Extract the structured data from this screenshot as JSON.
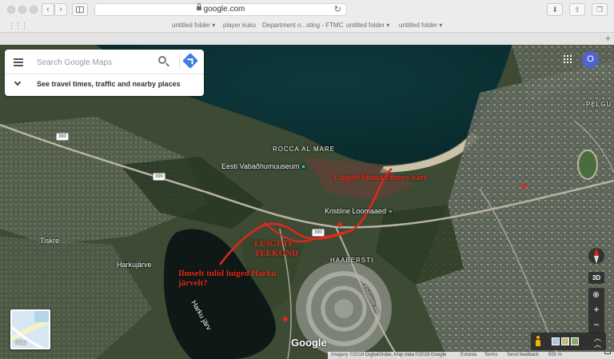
{
  "browser": {
    "url": "google.com",
    "bookmarks": [
      "untitled folder",
      "player kuku",
      "Department o...sting - FTMC",
      "untitled folder",
      "untitled folder"
    ]
  },
  "maps": {
    "search": {
      "placeholder": "Search Google Maps"
    },
    "travel_prompt": "See travel times, traffic and nearby places",
    "avatar_initial": "O",
    "map_type_label": "Map",
    "logo": "Google",
    "btn_3d": "3D",
    "zoom_in": "+",
    "zoom_out": "−",
    "labels": {
      "rocca_al_mare": "ROCCA AL MARE",
      "museum": "Eesti Vabaõhumuuseum",
      "kristiine": "Kristiine Loomaaed",
      "haabersti": "HAABERSTI",
      "tiskre": "Tiskre",
      "harkujarve": "Harkujärve",
      "harku_jarv": "Harku järv",
      "pelgu": "PELGU",
      "ehitajate": "Ehitajate tee"
    },
    "road_numbers": [
      "390",
      "390",
      "390"
    ],
    "annotations": {
      "a1": "Luiged lõunad mere äärt",
      "a2_line1": "LUIGETE",
      "a2_line2": "TEEKOND",
      "a3_line1": "Ilmselt tulid luiged Harku",
      "a3_line2": "järvelt?"
    },
    "footer": {
      "imagery": "Imagery ©2019 DigitalGlobe, Map data ©2019 Google",
      "country": "Estonia",
      "terms": "Terms",
      "feedback": "Send feedback",
      "scale": "500 m"
    },
    "colors": {
      "annotation": "#e0281c",
      "route": "#e0281c",
      "avatar": "#4f63d1"
    }
  }
}
